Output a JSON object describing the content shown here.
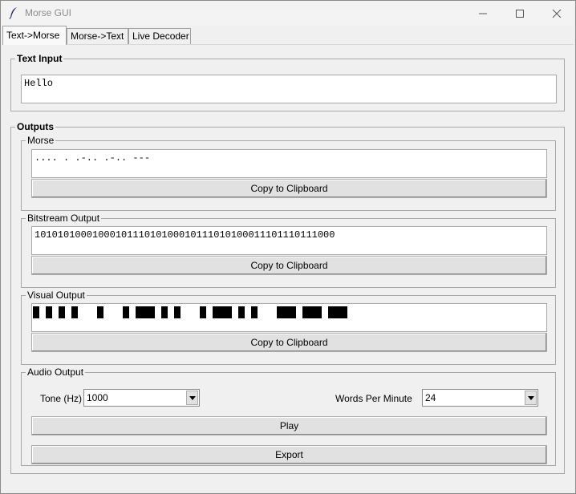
{
  "window": {
    "title": "Morse GUI"
  },
  "tabs": [
    "Text->Morse",
    "Morse->Text",
    "Live Decoder"
  ],
  "text_input": {
    "label": "Text Input",
    "value": "Hello"
  },
  "outputs": {
    "label": "Outputs",
    "morse": {
      "label": "Morse",
      "value": ".... . .-.. .-.. ---",
      "copy_label": "Copy to Clipboard"
    },
    "bitstream": {
      "label": "Bitstream Output",
      "value": "1010101000100010111010100010111010100011101110111000",
      "copy_label": "Copy to Clipboard"
    },
    "visual": {
      "label": "Visual Output",
      "copy_label": "Copy to Clipboard"
    },
    "audio": {
      "label": "Audio Output",
      "tone_label": "Tone (Hz)",
      "tone_value": "1000",
      "wpm_label": "Words Per Minute",
      "wpm_value": "24",
      "play_label": "Play",
      "export_label": "Export"
    }
  },
  "icons": {
    "app": "feather-icon",
    "minimize": "minimize-icon",
    "maximize": "maximize-icon",
    "close": "close-icon"
  }
}
